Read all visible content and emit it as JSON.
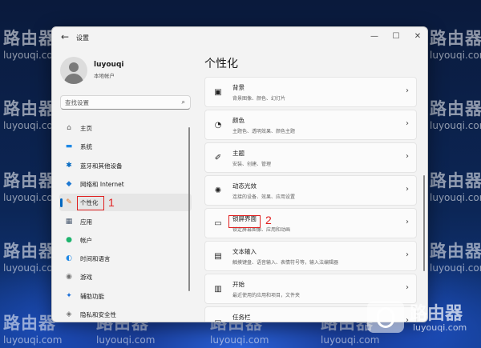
{
  "watermark": {
    "cn": "路由器",
    "en": "luyouqi.com"
  },
  "window": {
    "title": "设置",
    "back_icon": "arrow-left-icon",
    "controls": {
      "minimize": "—",
      "maximize": "☐",
      "close": "✕"
    }
  },
  "profile": {
    "name": "luyouqi",
    "account_type": "本地帐户"
  },
  "search": {
    "placeholder": "查找设置",
    "icon": "search-icon"
  },
  "sidebar": {
    "items": [
      {
        "label": "主页",
        "icon": "home-icon",
        "glyph": "⌂",
        "color": "#5a5a5a"
      },
      {
        "label": "系统",
        "icon": "monitor-icon",
        "glyph": "▬",
        "color": "#1e88e5"
      },
      {
        "label": "蓝牙和其他设备",
        "icon": "bluetooth-icon",
        "glyph": "✱",
        "color": "#0067c0"
      },
      {
        "label": "网络和 Internet",
        "icon": "wifi-icon",
        "glyph": "◆",
        "color": "#1e78d2"
      },
      {
        "label": "个性化",
        "icon": "brush-icon",
        "glyph": "✎",
        "color": "#e07020"
      },
      {
        "label": "应用",
        "icon": "apps-icon",
        "glyph": "▦",
        "color": "#4a5a70"
      },
      {
        "label": "帐户",
        "icon": "account-icon",
        "glyph": "●",
        "color": "#1eb46e"
      },
      {
        "label": "时间和语言",
        "icon": "globe-clock-icon",
        "glyph": "◐",
        "color": "#1e88e5"
      },
      {
        "label": "游戏",
        "icon": "gamepad-icon",
        "glyph": "◉",
        "color": "#707070"
      },
      {
        "label": "辅助功能",
        "icon": "accessibility-icon",
        "glyph": "✦",
        "color": "#1a6ed8"
      },
      {
        "label": "隐私和安全性",
        "icon": "shield-icon",
        "glyph": "◈",
        "color": "#707070"
      }
    ],
    "selected_index": 4
  },
  "main": {
    "title": "个性化",
    "cards": [
      {
        "title": "背景",
        "subtitle": "背景图像、颜色、幻灯片",
        "icon": "image-icon",
        "glyph": "▣"
      },
      {
        "title": "颜色",
        "subtitle": "主题色、透明效果、颜色主题",
        "icon": "palette-icon",
        "glyph": "◔"
      },
      {
        "title": "主题",
        "subtitle": "安装、创建、管理",
        "icon": "pen-icon",
        "glyph": "✐"
      },
      {
        "title": "动态光效",
        "subtitle": "连接的设备、效果、应用设置",
        "icon": "sun-icon",
        "glyph": "✺"
      },
      {
        "title": "锁屏界面",
        "subtitle": "锁定屏幕图像、应用和动画",
        "icon": "lock-screen-icon",
        "glyph": "▭"
      },
      {
        "title": "文本输入",
        "subtitle": "触摸键盘、语音输入、表情符号等，输入法编辑器",
        "icon": "keyboard-icon",
        "glyph": "▤"
      },
      {
        "title": "开始",
        "subtitle": "最近使用的应用和项目，文件夹",
        "icon": "start-icon",
        "glyph": "▥"
      },
      {
        "title": "任务栏",
        "subtitle": "",
        "icon": "taskbar-icon",
        "glyph": "▭"
      }
    ]
  },
  "annotations": {
    "step1": "1",
    "step2": "2",
    "color": "#e02020"
  }
}
